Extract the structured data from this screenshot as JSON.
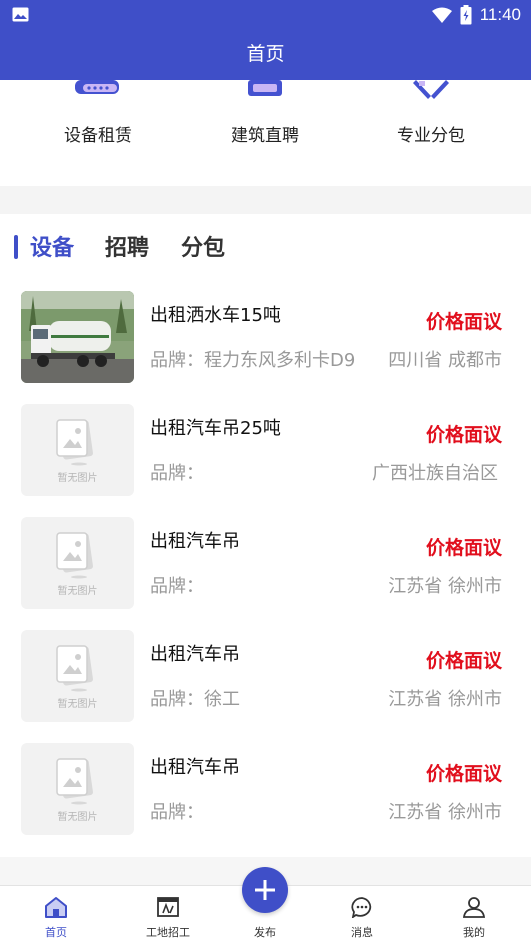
{
  "status_bar": {
    "time": "11:40"
  },
  "header": {
    "title": "首页"
  },
  "categories": [
    {
      "label": "设备租赁",
      "icon": "truck-icon"
    },
    {
      "label": "建筑直聘",
      "icon": "hardhat-icon"
    },
    {
      "label": "专业分包",
      "icon": "tools-icon"
    }
  ],
  "tabs": [
    {
      "label": "设备",
      "active": true
    },
    {
      "label": "招聘",
      "active": false
    },
    {
      "label": "分包",
      "active": false
    }
  ],
  "placeholder_text": "暂无图片",
  "listings": [
    {
      "title": "出租洒水车15吨",
      "price": "价格面议",
      "brand_label": "品牌：",
      "brand": "程力东风多利卡D9",
      "location": "四川省 成都市",
      "has_photo": true
    },
    {
      "title": "出租汽车吊25吨",
      "price": "价格面议",
      "brand_label": "品牌：",
      "brand": "",
      "location": "广西壮族自治区",
      "has_photo": false
    },
    {
      "title": "出租汽车吊",
      "price": "价格面议",
      "brand_label": "品牌：",
      "brand": "",
      "location": "江苏省 徐州市",
      "has_photo": false
    },
    {
      "title": "出租汽车吊",
      "price": "价格面议",
      "brand_label": "品牌：",
      "brand": "徐工",
      "location": "江苏省 徐州市",
      "has_photo": false
    },
    {
      "title": "出租汽车吊",
      "price": "价格面议",
      "brand_label": "品牌：",
      "brand": "",
      "location": "江苏省 徐州市",
      "has_photo": false
    }
  ],
  "tab_bar": [
    {
      "label": "首页",
      "icon": "home-icon",
      "active": true
    },
    {
      "label": "工地招工",
      "icon": "worksite-icon",
      "active": false
    },
    {
      "label": "发布",
      "icon": "plus-icon",
      "active": false
    },
    {
      "label": "消息",
      "icon": "chat-icon",
      "active": false
    },
    {
      "label": "我的",
      "icon": "user-icon",
      "active": false
    }
  ],
  "colors": {
    "primary": "#3f4fc8",
    "price": "#e10f1d",
    "muted": "#999999"
  }
}
